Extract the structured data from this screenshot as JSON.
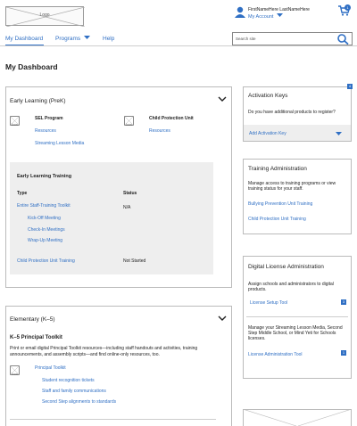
{
  "header": {
    "logo_label": "Logo",
    "user_name": "FirstNameHere LastNameHere",
    "account_label": "My Account",
    "cart_count": "1"
  },
  "nav": {
    "items": [
      {
        "label": "My Dashboard"
      },
      {
        "label": "Programs"
      },
      {
        "label": "Help"
      }
    ],
    "search_placeholder": "Search site"
  },
  "page_title": "My Dashboard",
  "early_learning": {
    "title": "Early Learning (PreK)",
    "icon_label": "Icon",
    "sel": {
      "title": "SEL Program",
      "links": [
        "Resources",
        "Streaming Lesson Media"
      ]
    },
    "child_protection": {
      "title": "Child Protection Unit",
      "links": [
        "Resources"
      ]
    },
    "training": {
      "title": "Early Learning Training",
      "col_type": "Type",
      "col_status": "Status",
      "rows": [
        {
          "type": "Entire Staff-Training Toolkit",
          "status": "N/A"
        },
        {
          "type": "Kick-Off Meeting",
          "status": ""
        },
        {
          "type": "Check-In Meetings",
          "status": ""
        },
        {
          "type": "Wrap-Up Meeting",
          "status": ""
        },
        {
          "type": "Child Protection Unit Training",
          "status": "Not Started"
        }
      ]
    }
  },
  "elementary": {
    "title": "Elementary (K–5)",
    "toolkit_title": "K–5 Principal Toolkit",
    "toolkit_desc": "Print or email digital Principal Toolkit resources—including staff handouts and activities, training announcements, and assembly scripts—and find online-only resources, too.",
    "icon_label": "Icon",
    "links": [
      "Principal Toolkit",
      "Student recognition tickets",
      "Staff and family communications",
      "Second Step alignments to standards"
    ]
  },
  "activation": {
    "badge": "4",
    "title": "Activation Keys",
    "desc": "Do you have additional products to register?",
    "add_label": "Add Activation Key"
  },
  "training_admin": {
    "title": "Training Administration",
    "desc": "Manage access to training programs or view training status for your staff.",
    "links": [
      "Bullying Prevention Unit Training",
      "Child Protection Unit Training"
    ]
  },
  "license_admin": {
    "title": "Digital License Administration",
    "desc1": "Assign schools and administrators to digital products.",
    "link1": "License Setup Tool",
    "badge1": "3",
    "desc2": "Manage your Streaming Lesson Media, Second Step Middle School, or Mind Yeti for Schools licenses.",
    "link2": "License Administration Tool",
    "badge2": "1"
  }
}
